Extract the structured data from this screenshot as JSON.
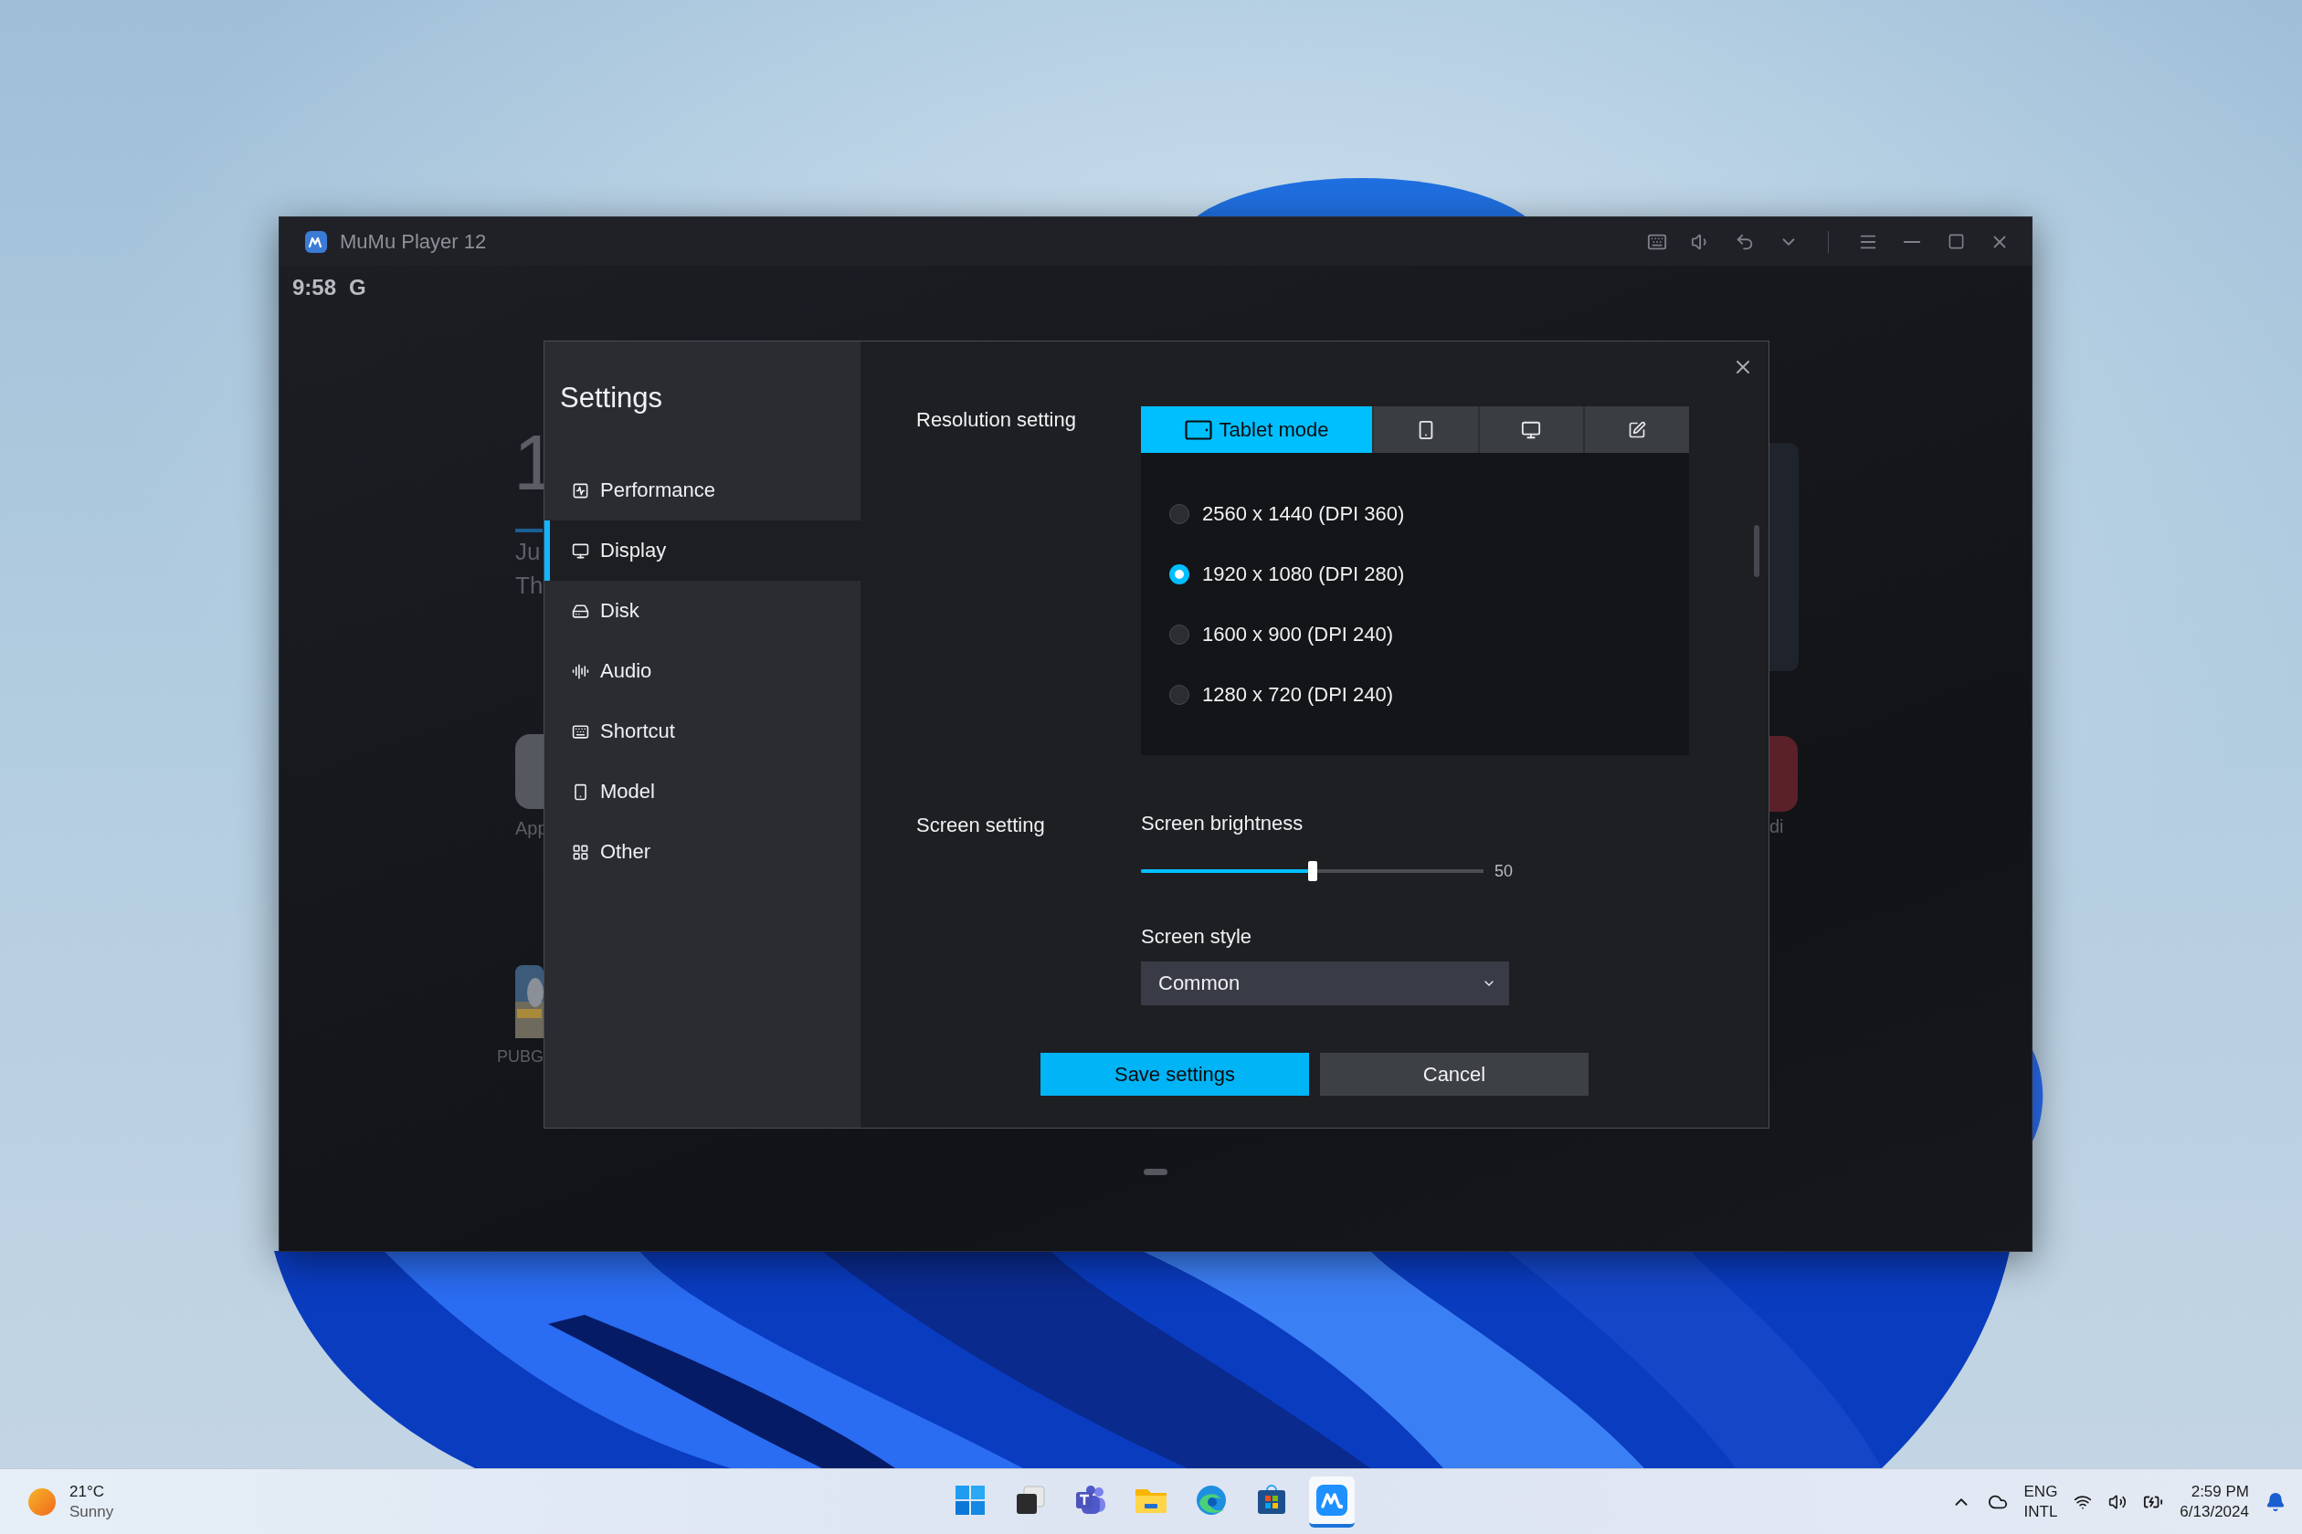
{
  "window": {
    "title": "MuMu Player 12"
  },
  "android": {
    "status": {
      "time": "9:58",
      "account": "G"
    },
    "home_texts": [
      "1",
      "Ju",
      "Th",
      "App",
      "PUBG",
      "di"
    ]
  },
  "settings": {
    "title": "Settings",
    "nav": [
      {
        "label": "Performance",
        "selected": false
      },
      {
        "label": "Display",
        "selected": true
      },
      {
        "label": "Disk",
        "selected": false
      },
      {
        "label": "Audio",
        "selected": false
      },
      {
        "label": "Shortcut",
        "selected": false
      },
      {
        "label": "Model",
        "selected": false
      },
      {
        "label": "Other",
        "selected": false
      }
    ],
    "resolution": {
      "label": "Resolution setting",
      "modes": [
        {
          "label": "Tablet mode",
          "selected": true
        },
        {
          "selected": false
        },
        {
          "selected": false
        },
        {
          "selected": false
        }
      ],
      "options": [
        {
          "label": "2560 x 1440 (DPI 360)",
          "selected": false
        },
        {
          "label": "1920 x 1080 (DPI 280)",
          "selected": true
        },
        {
          "label": "1600 x 900 (DPI 240)",
          "selected": false
        },
        {
          "label": "1280 x 720 (DPI 240)",
          "selected": false
        }
      ]
    },
    "screen": {
      "label": "Screen setting",
      "brightness_label": "Screen brightness",
      "level": 0.5,
      "reading": "50",
      "style_label": "Screen style",
      "style_value": "Common"
    },
    "buttons": [
      {
        "label": "Save settings",
        "kind": "primary"
      },
      {
        "label": "Cancel",
        "kind": "secondary"
      }
    ]
  },
  "taskbar": {
    "weather": {
      "temperature": "21°C",
      "condition": "Sunny"
    },
    "apps": [
      {
        "selected": false
      },
      {
        "selected": false
      },
      {
        "selected": false
      },
      {
        "selected": false
      },
      {
        "selected": false
      },
      {
        "selected": false
      },
      {
        "selected": true
      }
    ],
    "language": "ENG",
    "layout": "INTL",
    "time": "2:59 PM",
    "date": "6/13/2024"
  }
}
